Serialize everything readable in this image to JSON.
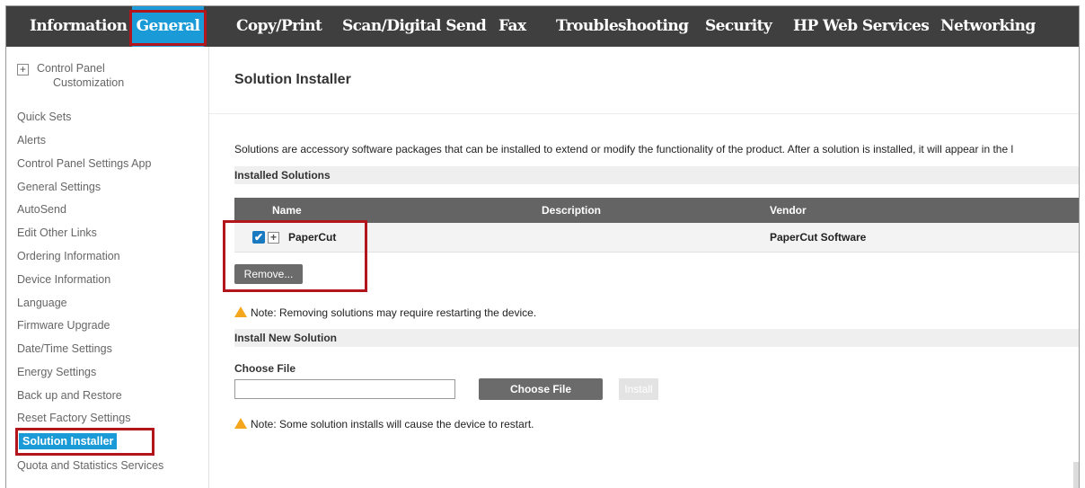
{
  "nav": {
    "tabs": [
      "Information",
      "General",
      "Copy/Print",
      "Scan/Digital Send",
      "Fax",
      "Troubleshooting",
      "Security",
      "HP Web Services",
      "Networking"
    ],
    "active_tab": "General",
    "active_color": "#1a9ad6",
    "highlight_color": "#b2151b"
  },
  "sidebar": {
    "expandable_item": {
      "line1": "Control Panel",
      "line2": "Customization",
      "icon": "plus-box-icon"
    },
    "items": [
      "Quick Sets",
      "Alerts",
      "Control Panel Settings App",
      "General Settings",
      "AutoSend",
      "Edit Other Links",
      "Ordering Information",
      "Device Information",
      "Language",
      "Firmware Upgrade",
      "Date/Time Settings",
      "Energy Settings",
      "Back up and Restore",
      "Reset Factory Settings",
      "Solution Installer",
      "Quota and Statistics Services"
    ],
    "active_item": "Solution Installer"
  },
  "main": {
    "title": "Solution Installer",
    "intro": "Solutions are accessory software packages that can be installed to extend or modify the functionality of the product. After a solution is installed, it will appear in the l",
    "installed": {
      "heading": "Installed Solutions",
      "columns": [
        "Name",
        "Description",
        "Vendor"
      ],
      "rows": [
        {
          "name": "PaperCut",
          "description": "",
          "vendor": "PaperCut Software",
          "checked": true
        }
      ],
      "remove_label": "Remove...",
      "note": "Note: Removing solutions may require restarting the device."
    },
    "install_new": {
      "heading": "Install New Solution",
      "choose_file_label": "Choose File",
      "file_value": "",
      "choose_file_button": "Choose File",
      "install_button": "Install",
      "note": "Note: Some solution installs will cause the device to restart."
    }
  }
}
